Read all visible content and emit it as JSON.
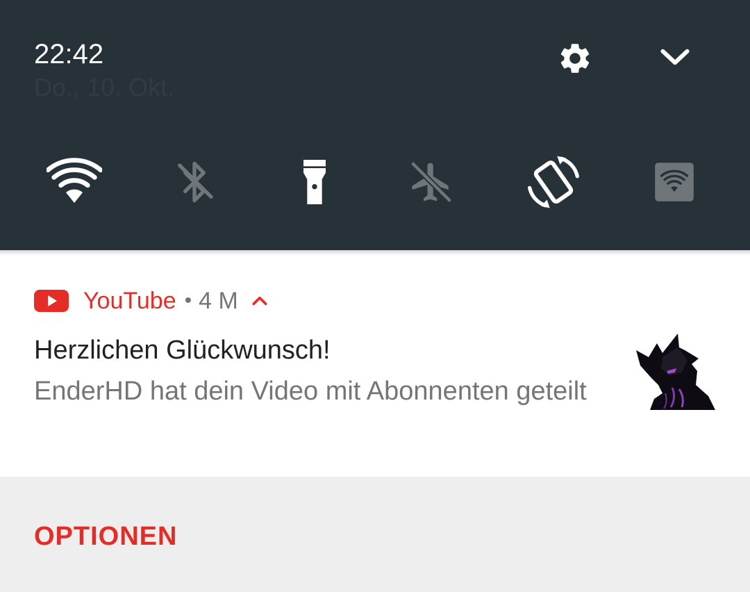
{
  "status": {
    "time": "22:42",
    "date": "Do., 10. Okt."
  },
  "header_icons": {
    "settings": "gear-icon",
    "expand": "chevron-down-icon"
  },
  "quick_tiles": [
    {
      "icon": "wifi-icon",
      "state": "on"
    },
    {
      "icon": "bluetooth-off-icon",
      "state": "off"
    },
    {
      "icon": "flashlight-icon",
      "state": "on"
    },
    {
      "icon": "airplane-mode-off-icon",
      "state": "off"
    },
    {
      "icon": "auto-rotate-icon",
      "state": "on"
    },
    {
      "icon": "hotspot-icon",
      "state": "off"
    }
  ],
  "notification": {
    "app_icon": "youtube-icon",
    "app_name": "YouTube",
    "separator": "•",
    "age": "4 M",
    "title": "Herzlichen Glückwunsch!",
    "body": "EnderHD hat dein Video mit Abonnenten geteilt",
    "thumbnail": "creature-avatar-thumbnail"
  },
  "actions": {
    "options_label": "OPTIONEN"
  },
  "colors": {
    "shade_background": "#263238",
    "accent_red": "#e52d27",
    "secondary_text": "#757575",
    "primary_text": "#212121"
  }
}
